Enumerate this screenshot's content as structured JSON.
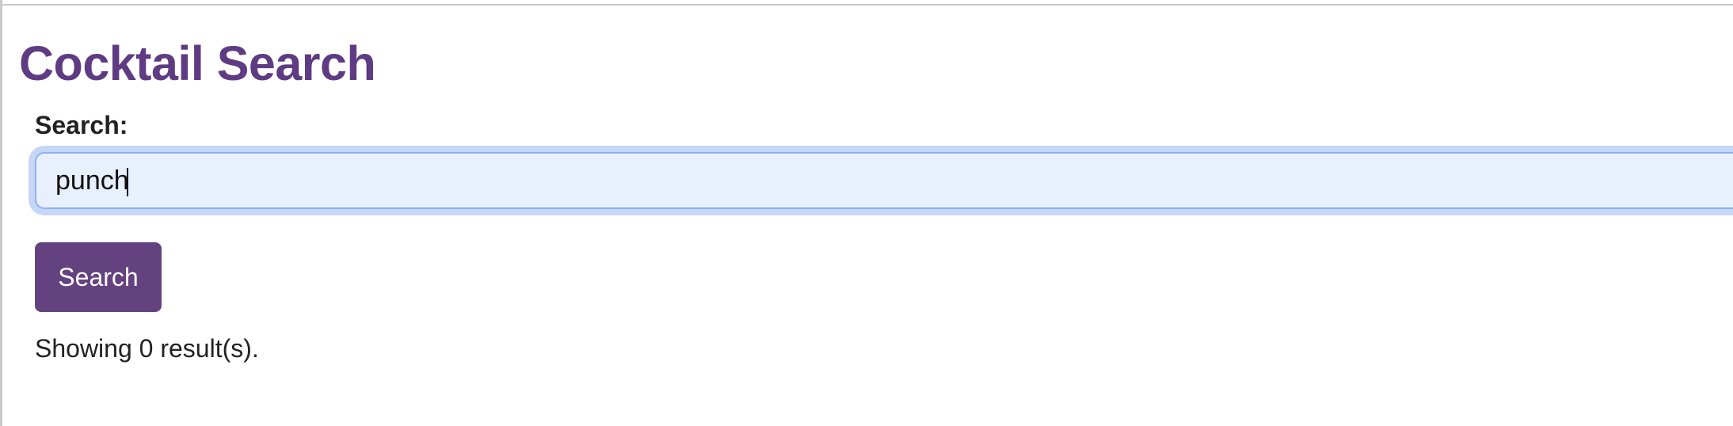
{
  "page": {
    "title": "Cocktail Search"
  },
  "search": {
    "label": "Search:",
    "value": "punch",
    "placeholder": ""
  },
  "actions": {
    "search_button_label": "Search"
  },
  "results": {
    "summary": "Showing 0 result(s)."
  },
  "colors": {
    "title": "#5e3b82",
    "button_bg": "#64427f",
    "input_bg": "#e8effd",
    "input_border": "#8fb0ee",
    "focus_ring": "#c5d6f6"
  }
}
